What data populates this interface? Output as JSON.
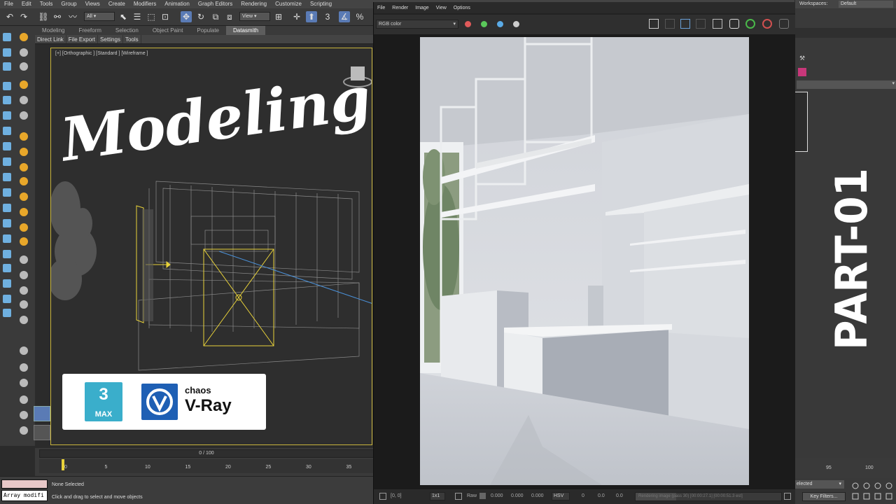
{
  "menubar": {
    "items": [
      "File",
      "Edit",
      "Tools",
      "Group",
      "Views",
      "Create",
      "Modifiers",
      "Animation",
      "Graph Editors",
      "Rendering",
      "Customize",
      "Scripting"
    ]
  },
  "toolbar": {
    "selection_filter": "All",
    "view_dropdown": "View",
    "snap_label": "3"
  },
  "ribbon": {
    "tabs": [
      "Modeling",
      "Freeform",
      "Selection",
      "Object Paint",
      "Populate",
      "Datasmith"
    ],
    "active_tab": "Datasmith",
    "sub_tabs": [
      "Direct Link",
      "File Export",
      "Settings",
      "Tools"
    ]
  },
  "viewport": {
    "label": "[+] [Orthographic ] [Standard ] [Wireframe ]",
    "overlay_title": "Modeling"
  },
  "logos": {
    "max_number": "3",
    "max_text": "MAX",
    "chaos_text": "chaos",
    "vray_text": "V-Ray"
  },
  "vfb": {
    "menu": [
      "File",
      "Render",
      "Image",
      "View",
      "Options"
    ],
    "channel": "RGB color",
    "status": {
      "coords": "[0, 0]",
      "zoom": "1x1",
      "raw_label": "Raw",
      "raw_values": [
        "0.000",
        "0.000",
        "0.000"
      ],
      "color_mode": "HSV",
      "hsv_values": [
        "0",
        "0.0",
        "0.0"
      ],
      "progress_text": "Rendering image (pass 30) [00:00:27.1] [00:00:51.3 est]"
    },
    "colors": {
      "red": "#e05a5a",
      "green": "#5ac85a",
      "blue": "#5aaae6"
    }
  },
  "timeline": {
    "frame_counter": "0 / 100",
    "ticks": [
      "0",
      "5",
      "10",
      "15",
      "20",
      "25",
      "30",
      "35"
    ],
    "right_ticks": [
      "95",
      "100"
    ]
  },
  "statusbar": {
    "script_field": "Array modifi",
    "selection": "None Selected",
    "prompt": "Click and drag to select and move objects"
  },
  "rightpanel": {
    "workspaces_label": "Workspaces:",
    "workspace_value": "Default",
    "selected_dropdown": "elected",
    "key_filters": "Key Filters...",
    "swatch_color": "#c8377a"
  },
  "overlay": {
    "part_text": "PART-01"
  }
}
